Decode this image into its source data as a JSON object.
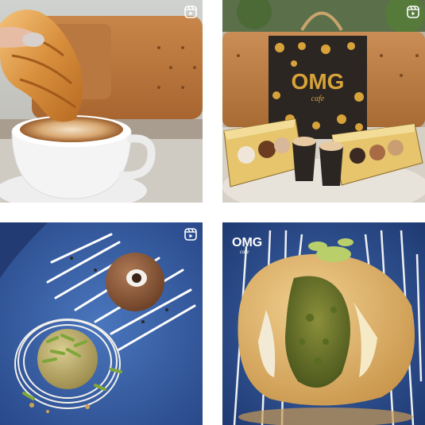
{
  "feed": {
    "posts": [
      {
        "type": "reel",
        "icon": "reels-icon",
        "subject": "croissant on latte cup"
      },
      {
        "type": "reel",
        "icon": "reels-icon",
        "subject": "OMG cafe bag with dessert boxes and coffees",
        "bag_logo": "OMG",
        "bag_sub": "cafe"
      },
      {
        "type": "reel",
        "icon": "reels-icon",
        "subject": "pistachio and cocoa dessert balls on blue plate"
      },
      {
        "type": "image",
        "icon": "",
        "subject": "pistachio filled crumb ball",
        "watermark": "OMG",
        "watermark_sub": "cafe"
      }
    ]
  },
  "colors": {
    "badge": "#ffffff",
    "plate_blue": "#3a63a8",
    "brand_gold": "#d8a23a"
  }
}
